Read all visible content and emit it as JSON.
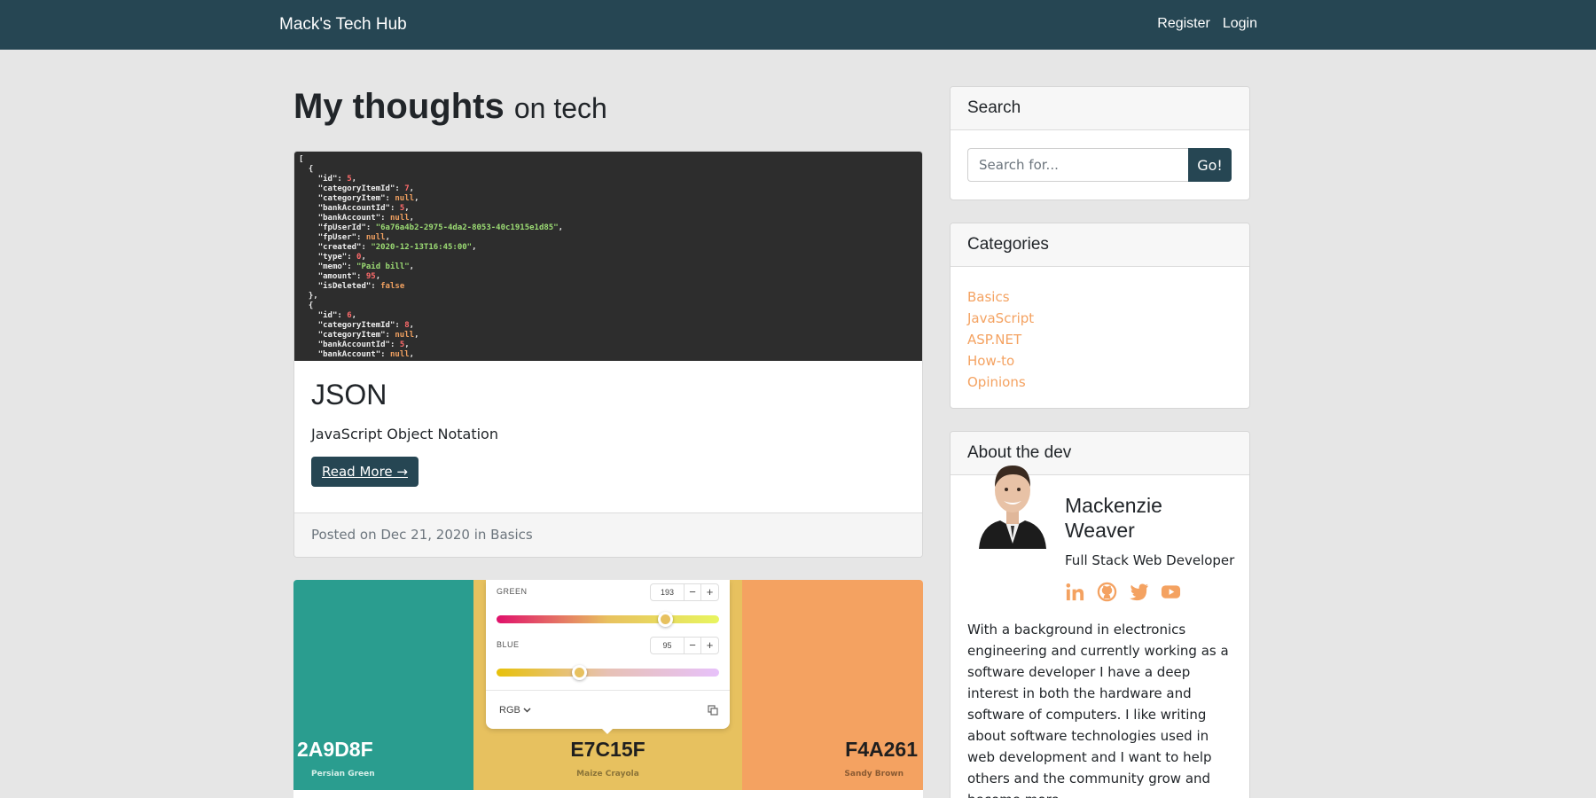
{
  "navbar": {
    "brand": "Mack's Tech Hub",
    "register": "Register",
    "login": "Login"
  },
  "page": {
    "title_main": "My thoughts",
    "title_sub": "on tech"
  },
  "posts": [
    {
      "title": "JSON",
      "excerpt": "JavaScript Object Notation",
      "read_more": "Read More →",
      "footer_prefix": "Posted on Dec 21, 2020 in",
      "category": "Basics",
      "image_code": [
        "[",
        "  {",
        "    \"id\": 5,",
        "    \"categoryItemId\": 7,",
        "    \"categoryItem\": null,",
        "    \"bankAccountId\": 5,",
        "    \"bankAccount\": null,",
        "    \"fpUserId\": \"6a76a4b2-2975-4da2-8053-40c1915e1d85\",",
        "    \"fpUser\": null,",
        "    \"created\": \"2020-12-13T16:45:00\",",
        "    \"type\": 0,",
        "    \"memo\": \"Paid bill\",",
        "    \"amount\": 95,",
        "    \"isDeleted\": false",
        "  },",
        "  {",
        "    \"id\": 6,",
        "    \"categoryItemId\": 8,",
        "    \"categoryItem\": null,",
        "    \"bankAccountId\": 5,",
        "    \"bankAccount\": null,"
      ]
    },
    {
      "swatches": [
        {
          "hex": "2A9D8F",
          "name": "Persian Green",
          "color": "#2a9d8f"
        },
        {
          "hex": "E7C15F",
          "name": "Maize Crayola",
          "color": "#e7c15f"
        },
        {
          "hex": "F4A261",
          "name": "Sandy Brown",
          "color": "#f4a261"
        }
      ],
      "picker": {
        "green_label": "GREEN",
        "green_value": "193",
        "blue_label": "BLUE",
        "blue_value": "95",
        "mode": "RGB",
        "minus": "−",
        "plus": "+",
        "green_level": 0.757,
        "blue_level": 0.373
      }
    }
  ],
  "search": {
    "heading": "Search",
    "placeholder": "Search for...",
    "button": "Go!"
  },
  "categories": {
    "heading": "Categories",
    "items": [
      "Basics",
      "JavaScript",
      "ASP.NET",
      "How-to",
      "Opinions"
    ]
  },
  "about": {
    "heading": "About the dev",
    "name": "Mackenzie Weaver",
    "role": "Full Stack Web Developer",
    "socials": [
      "linkedin-icon",
      "github-icon",
      "twitter-icon",
      "youtube-icon"
    ],
    "bio": "With a background in electronics engineering and currently working as a software developer I have a deep interest in both the hardware and software of computers. I like writing about software technologies used in web development and I want to help others and the community grow and become more"
  },
  "colors": {
    "navbar": "#264653",
    "accent": "#f4a261",
    "button": "#264653"
  }
}
